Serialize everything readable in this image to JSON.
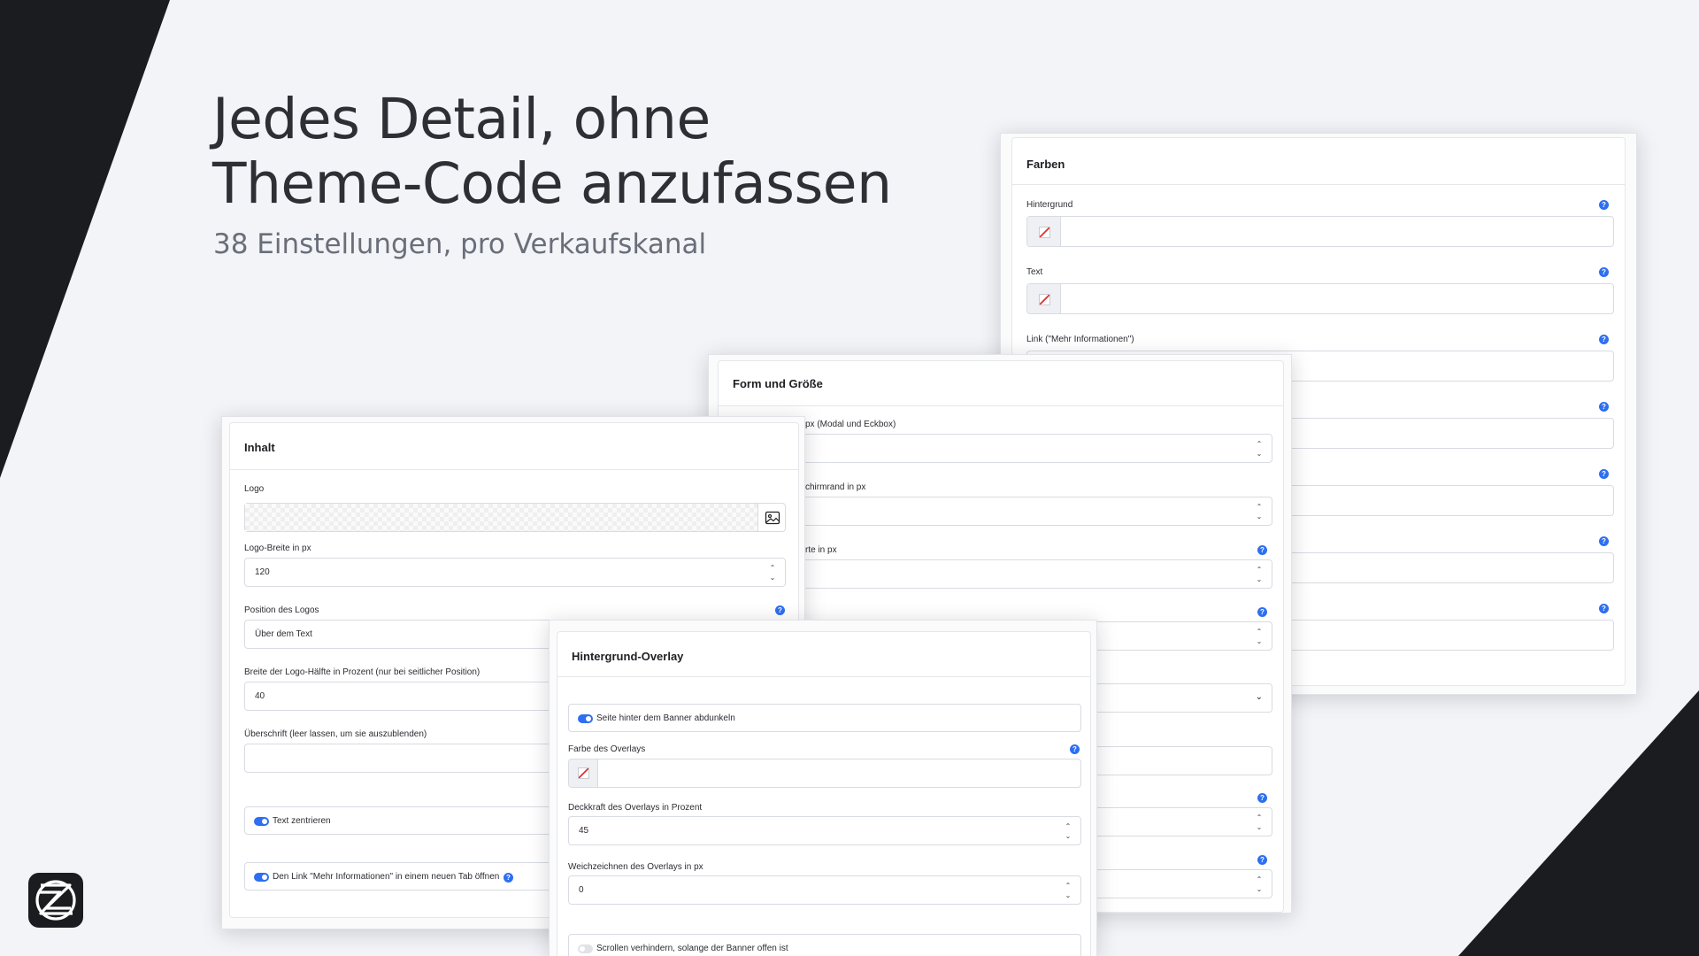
{
  "hero": {
    "headline_line1": "Jedes Detail, ohne",
    "headline_line2": "Theme-Code anzufassen",
    "subline": "38 Einstellungen, pro Verkaufskanal"
  },
  "colors": {
    "accent": "#2d6ff0",
    "dark": "#1b1c20",
    "background": "#f3f4f8"
  },
  "farben": {
    "title": "Farben",
    "fields": [
      {
        "label": "Hintergrund",
        "value": ""
      },
      {
        "label": "Text",
        "value": ""
      },
      {
        "label": "Link (\"Mehr Informationen\")",
        "value": ""
      }
    ]
  },
  "form": {
    "title": "Form und Größe",
    "fields": [
      {
        "label": "px (Modal und Eckbox)",
        "value": ""
      },
      {
        "label": "chirmrand in px",
        "value": ""
      },
      {
        "label": "rte in px",
        "value": ""
      }
    ]
  },
  "inhalt": {
    "title": "Inhalt",
    "logo_label": "Logo",
    "logo_width_label": "Logo-Breite in px",
    "logo_width_value": "120",
    "position_label": "Position des Logos",
    "position_value": "Über dem Text",
    "half_label": "Breite der Logo-Hälfte in Prozent (nur bei seitlicher Position)",
    "half_value": "40",
    "heading_label": "Überschrift (leer lassen, um sie auszublenden)",
    "heading_value": "",
    "center_toggle": "Text zentrieren",
    "newtab_toggle": "Den Link \"Mehr Informationen\" in einem neuen Tab öffnen"
  },
  "overlay": {
    "title": "Hintergrund-Overlay",
    "darken_toggle": "Seite hinter dem Banner abdunkeln",
    "color_label": "Farbe des Overlays",
    "opacity_label": "Deckkraft des Overlays in Prozent",
    "opacity_value": "45",
    "blur_label": "Weichzeichnen des Overlays in px",
    "blur_value": "0",
    "scroll_toggle": "Scrollen verhindern, solange der Banner offen ist"
  },
  "icons": {
    "help": "help-circle-icon",
    "image": "image-icon",
    "stepper": "stepper-icon",
    "chevron": "chevron-down-icon",
    "brand": "brand-logo-icon"
  }
}
